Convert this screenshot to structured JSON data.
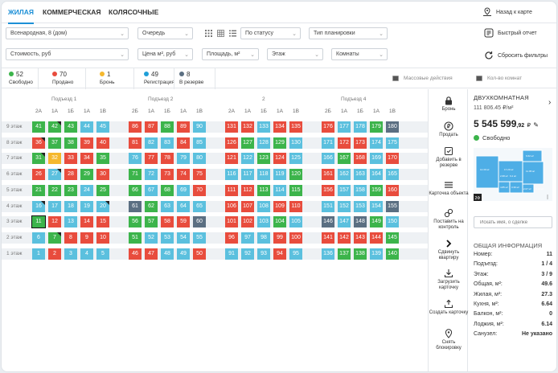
{
  "tabs": [
    "ЖИЛАЯ",
    "КОММЕРЧЕСКАЯ",
    "КОЛЯСОЧНЫЕ"
  ],
  "topbar": {
    "back_map": "Назад к карте",
    "quick_report": "Быстрый отчет",
    "reset_filters": "Сбросить фильтры"
  },
  "filters": {
    "address": "Всенародная, 8 (дом)",
    "queue": "Очередь",
    "status": "По статусу",
    "layout": "Тип планировки",
    "cost": "Стоимость, руб",
    "price_m2": "Цена м², руб",
    "area": "Площадь, м²",
    "floor": "Этаж",
    "rooms": "Комнаты"
  },
  "stats": [
    {
      "num": "52",
      "label": "Свободно",
      "color": "#3cb44b"
    },
    {
      "num": "70",
      "label": "Продано",
      "color": "#e84c3d"
    },
    {
      "num": "1",
      "label": "Бронь",
      "color": "#f5b82e"
    },
    {
      "num": "49",
      "label": "Регистрация",
      "color": "#1f9fd8"
    },
    {
      "num": "8",
      "label": "В резерве",
      "color": "#5b6f82"
    }
  ],
  "mass_actions": "Массовые действия",
  "rooms_count": "Кол-во комнат",
  "colors": {
    "g": "#3cb44b",
    "r": "#e84c3d",
    "y": "#f5b82e",
    "c": "#5bc0de",
    "d": "#5b6f82"
  },
  "floors": [
    "9 этаж",
    "8 этаж",
    "7 этаж",
    "6 этаж",
    "5 этаж",
    "4 этаж",
    "3 этаж",
    "2 этаж",
    "1 этаж"
  ],
  "sections": [
    {
      "name": "Подъезд 1",
      "cols": [
        "2А",
        "1А",
        "1Б",
        "1А",
        "1В"
      ],
      "rows": [
        [
          [
            "41",
            "g"
          ],
          [
            "42",
            "g"
          ],
          [
            "43",
            "g"
          ],
          [
            "44",
            "c"
          ],
          [
            "45",
            "c"
          ]
        ],
        [
          [
            "36",
            "r"
          ],
          [
            "37",
            "g"
          ],
          [
            "38",
            "g"
          ],
          [
            "39",
            "r"
          ],
          [
            "40",
            "r"
          ]
        ],
        [
          [
            "31",
            "g"
          ],
          [
            "32",
            "y"
          ],
          [
            "33",
            "r"
          ],
          [
            "34",
            "r"
          ],
          [
            "35",
            "g"
          ]
        ],
        [
          [
            "26",
            "r"
          ],
          [
            "27",
            "c"
          ],
          [
            "28",
            "r"
          ],
          [
            "29",
            "g"
          ],
          [
            "30",
            "r"
          ]
        ],
        [
          [
            "21",
            "g"
          ],
          [
            "22",
            "g"
          ],
          [
            "23",
            "g"
          ],
          [
            "24",
            "c"
          ],
          [
            "25",
            "g"
          ]
        ],
        [
          [
            "16",
            "c"
          ],
          [
            "17",
            "c"
          ],
          [
            "18",
            "c"
          ],
          [
            "19",
            "c"
          ],
          [
            "20",
            "c"
          ]
        ],
        [
          [
            "11",
            "g"
          ],
          [
            "12",
            "r"
          ],
          [
            "13",
            "c"
          ],
          [
            "14",
            "r"
          ],
          [
            "15",
            "r"
          ]
        ],
        [
          [
            "6",
            "c"
          ],
          [
            "7",
            "g"
          ],
          [
            "8",
            "r"
          ],
          [
            "9",
            "r"
          ],
          [
            "10",
            "r"
          ]
        ],
        [
          [
            "1",
            "c"
          ],
          [
            "2",
            "r"
          ],
          [
            "3",
            "c"
          ],
          [
            "4",
            "c"
          ],
          [
            "5",
            "c"
          ]
        ]
      ]
    },
    {
      "name": "Подъезд 2",
      "cols": [
        "2Б",
        "1А",
        "1Б",
        "1А",
        "1В"
      ],
      "rows": [
        [
          [
            "86",
            "r"
          ],
          [
            "87",
            "r"
          ],
          [
            "88",
            "g"
          ],
          [
            "89",
            "r"
          ],
          [
            "90",
            "c"
          ]
        ],
        [
          [
            "81",
            "r"
          ],
          [
            "82",
            "c"
          ],
          [
            "83",
            "c"
          ],
          [
            "84",
            "r"
          ],
          [
            "85",
            "c"
          ]
        ],
        [
          [
            "76",
            "c"
          ],
          [
            "77",
            "r"
          ],
          [
            "78",
            "r"
          ],
          [
            "79",
            "c"
          ],
          [
            "80",
            "c"
          ]
        ],
        [
          [
            "71",
            "g"
          ],
          [
            "72",
            "c"
          ],
          [
            "73",
            "r"
          ],
          [
            "74",
            "r"
          ],
          [
            "75",
            "r"
          ]
        ],
        [
          [
            "66",
            "g"
          ],
          [
            "67",
            "c"
          ],
          [
            "68",
            "g"
          ],
          [
            "69",
            "c"
          ],
          [
            "70",
            "r"
          ]
        ],
        [
          [
            "61",
            "d"
          ],
          [
            "62",
            "g"
          ],
          [
            "63",
            "c"
          ],
          [
            "64",
            "c"
          ],
          [
            "65",
            "c"
          ]
        ],
        [
          [
            "56",
            "g"
          ],
          [
            "57",
            "g"
          ],
          [
            "58",
            "r"
          ],
          [
            "59",
            "r"
          ],
          [
            "60",
            "d"
          ]
        ],
        [
          [
            "51",
            "g"
          ],
          [
            "52",
            "c"
          ],
          [
            "53",
            "c"
          ],
          [
            "54",
            "c"
          ],
          [
            "55",
            "c"
          ]
        ],
        [
          [
            "46",
            "r"
          ],
          [
            "47",
            "r"
          ],
          [
            "48",
            "c"
          ],
          [
            "49",
            "c"
          ],
          [
            "50",
            "r"
          ]
        ]
      ]
    },
    {
      "name": "2",
      "cols": [
        "2А",
        "1А",
        "1Б",
        "1А",
        "1В"
      ],
      "rows": [
        [
          [
            "131",
            "r"
          ],
          [
            "132",
            "r"
          ],
          [
            "133",
            "c"
          ],
          [
            "134",
            "r"
          ],
          [
            "135",
            "r"
          ]
        ],
        [
          [
            "126",
            "r"
          ],
          [
            "127",
            "g"
          ],
          [
            "128",
            "c"
          ],
          [
            "129",
            "g"
          ],
          [
            "130",
            "c"
          ]
        ],
        [
          [
            "121",
            "r"
          ],
          [
            "122",
            "c"
          ],
          [
            "123",
            "g"
          ],
          [
            "124",
            "r"
          ],
          [
            "125",
            "c"
          ]
        ],
        [
          [
            "116",
            "c"
          ],
          [
            "117",
            "c"
          ],
          [
            "118",
            "c"
          ],
          [
            "119",
            "c"
          ],
          [
            "120",
            "g"
          ]
        ],
        [
          [
            "111",
            "r"
          ],
          [
            "112",
            "r"
          ],
          [
            "113",
            "g"
          ],
          [
            "114",
            "c"
          ],
          [
            "115",
            "g"
          ]
        ],
        [
          [
            "106",
            "r"
          ],
          [
            "107",
            "r"
          ],
          [
            "108",
            "c"
          ],
          [
            "109",
            "r"
          ],
          [
            "110",
            "r"
          ]
        ],
        [
          [
            "101",
            "r"
          ],
          [
            "102",
            "r"
          ],
          [
            "103",
            "c"
          ],
          [
            "104",
            "g"
          ],
          [
            "105",
            "c"
          ]
        ],
        [
          [
            "96",
            "r"
          ],
          [
            "97",
            "c"
          ],
          [
            "98",
            "c"
          ],
          [
            "99",
            "r"
          ],
          [
            "100",
            "r"
          ]
        ],
        [
          [
            "91",
            "c"
          ],
          [
            "92",
            "c"
          ],
          [
            "93",
            "c"
          ],
          [
            "94",
            "r"
          ],
          [
            "95",
            "c"
          ]
        ]
      ]
    },
    {
      "name": "Подъезд 4",
      "cols": [
        "2Б",
        "1А",
        "1Б",
        "1А",
        "1В"
      ],
      "rows": [
        [
          [
            "176",
            "r"
          ],
          [
            "177",
            "c"
          ],
          [
            "178",
            "c"
          ],
          [
            "179",
            "g"
          ],
          [
            "180",
            "d"
          ]
        ],
        [
          [
            "171",
            "c"
          ],
          [
            "172",
            "r"
          ],
          [
            "173",
            "r"
          ],
          [
            "174",
            "c"
          ],
          [
            "175",
            "c"
          ]
        ],
        [
          [
            "166",
            "c"
          ],
          [
            "167",
            "g"
          ],
          [
            "168",
            "r"
          ],
          [
            "169",
            "c"
          ],
          [
            "170",
            "r"
          ]
        ],
        [
          [
            "161",
            "r"
          ],
          [
            "162",
            "c"
          ],
          [
            "163",
            "c"
          ],
          [
            "164",
            "c"
          ],
          [
            "165",
            "c"
          ]
        ],
        [
          [
            "156",
            "r"
          ],
          [
            "157",
            "c"
          ],
          [
            "158",
            "c"
          ],
          [
            "159",
            "g"
          ],
          [
            "160",
            "r"
          ]
        ],
        [
          [
            "151",
            "c"
          ],
          [
            "152",
            "c"
          ],
          [
            "153",
            "c"
          ],
          [
            "154",
            "c"
          ],
          [
            "155",
            "d"
          ]
        ],
        [
          [
            "146",
            "d"
          ],
          [
            "147",
            "c"
          ],
          [
            "148",
            "d"
          ],
          [
            "149",
            "g"
          ],
          [
            "150",
            "c"
          ]
        ],
        [
          [
            "141",
            "r"
          ],
          [
            "142",
            "r"
          ],
          [
            "143",
            "r"
          ],
          [
            "144",
            "r"
          ],
          [
            "145",
            "g"
          ]
        ],
        [
          [
            "136",
            "c"
          ],
          [
            "137",
            "g"
          ],
          [
            "138",
            "g"
          ],
          [
            "139",
            "c"
          ],
          [
            "140",
            "g"
          ]
        ]
      ]
    }
  ],
  "tools": [
    "Бронь",
    "Продать",
    "Добавить в резерве",
    "Карточка объекта",
    "Поставить на контроль",
    "Сдвинуть квартиру",
    "Загрузить карточку",
    "Создать карточку",
    "Снять блокировку"
  ],
  "apartment": {
    "type": "ДВУХКОМНАТНАЯ",
    "price_m2": "111 806.45",
    "price_m2_unit": "₽/м²",
    "price": "5 545 599",
    "price_kop": ",92",
    "price_unit": "₽",
    "status": "Свободно",
    "plan_tag": "2Ф",
    "search_placeholder": "Искать имя, о сделке",
    "general_info": "ОБЩАЯ ИНФОРМАЦИЯ",
    "info": [
      [
        "Номер:",
        "11"
      ],
      [
        "Подъезд:",
        "1 / 4"
      ],
      [
        "Этаж:",
        "3 / 9"
      ],
      [
        "Общая, м²:",
        "49.6"
      ],
      [
        "Жилая, м²:",
        "27.3"
      ],
      [
        "Кухня, м²:",
        "6.64"
      ],
      [
        "Балкон, м²:",
        "0"
      ],
      [
        "Лоджия, м²:",
        "6.14"
      ],
      [
        "Санузел:",
        "Не указано"
      ]
    ],
    "plan_labels": [
      "14.39 м²",
      "17.29 м²",
      "2.68 м²",
      "6.2 м²",
      "11.95 м²",
      "4.85 м²",
      "3.39 м²",
      "6.62 м²",
      "2.07 м²",
      "5.18 м²"
    ]
  }
}
